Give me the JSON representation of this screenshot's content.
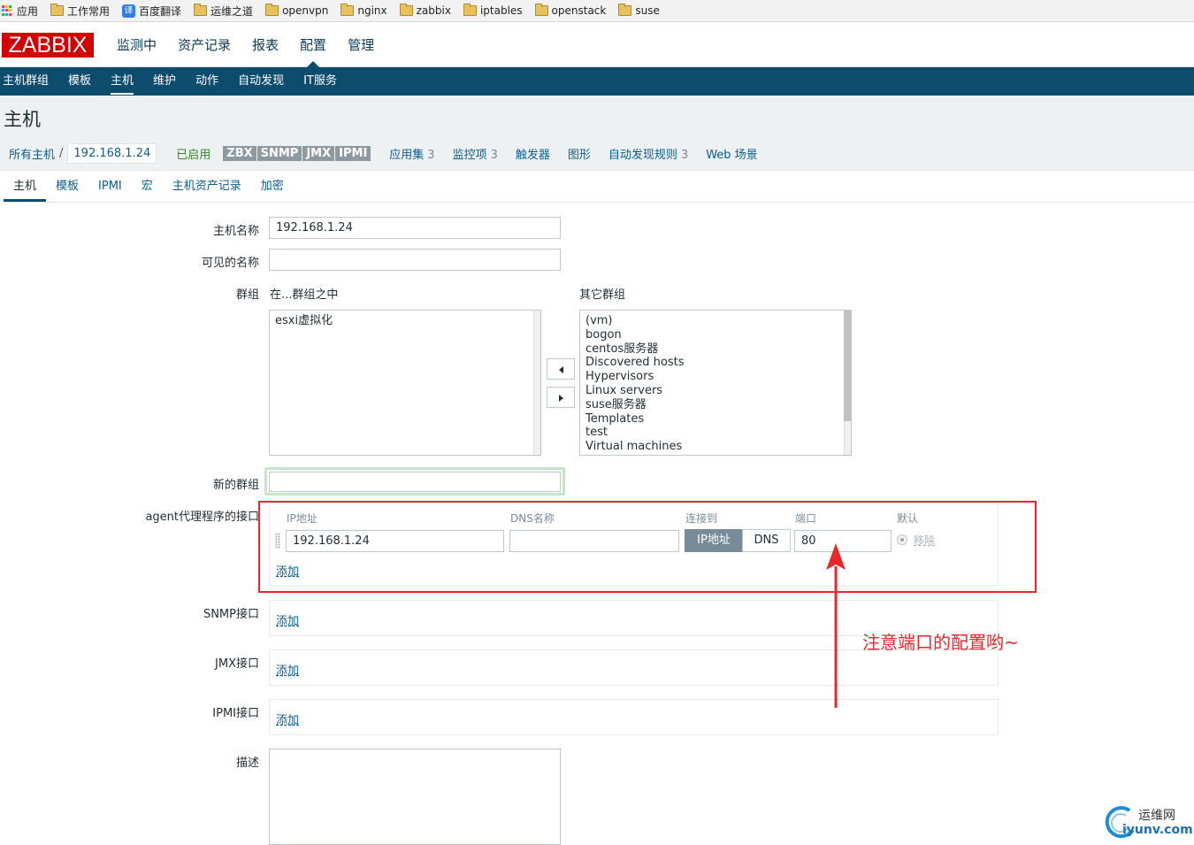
{
  "bookmarks": [
    {
      "label": "应用",
      "icon": "apps-grid-icon"
    },
    {
      "label": "工作常用",
      "icon": "folder-icon"
    },
    {
      "label": "百度翻译",
      "icon": "translate-icon",
      "icon_text": "译"
    },
    {
      "label": "运维之道",
      "icon": "folder-icon"
    },
    {
      "label": "openvpn",
      "icon": "folder-icon"
    },
    {
      "label": "nginx",
      "icon": "folder-icon"
    },
    {
      "label": "zabbix",
      "icon": "folder-icon"
    },
    {
      "label": "iptables",
      "icon": "folder-icon"
    },
    {
      "label": "openstack",
      "icon": "folder-icon"
    },
    {
      "label": "suse",
      "icon": "folder-icon"
    }
  ],
  "logo": "ZABBIX",
  "main_menu": [
    "监测中",
    "资产记录",
    "报表",
    "配置",
    "管理"
  ],
  "main_menu_active": "配置",
  "sub_menu": [
    "主机群组",
    "模板",
    "主机",
    "维护",
    "动作",
    "自动发现",
    "IT服务"
  ],
  "sub_menu_active": "主机",
  "page_title": "主机",
  "breadcrumb": {
    "all_hosts": "所有主机",
    "separator": "/",
    "current": "192.168.1.24",
    "status": "已启用",
    "availability": [
      "ZBX",
      "SNMP",
      "JMX",
      "IPMI"
    ],
    "items": [
      {
        "label": "应用集",
        "count": "3"
      },
      {
        "label": "监控项",
        "count": "3"
      },
      {
        "label": "触发器",
        "count": ""
      },
      {
        "label": "图形",
        "count": ""
      },
      {
        "label": "自动发现规则",
        "count": "3"
      },
      {
        "label": "Web 场景",
        "count": ""
      }
    ]
  },
  "tabs": [
    "主机",
    "模板",
    "IPMI",
    "宏",
    "主机资产记录",
    "加密"
  ],
  "tabs_active": "主机",
  "form": {
    "host_name_label": "主机名称",
    "host_name_value": "192.168.1.24",
    "visible_name_label": "可见的名称",
    "visible_name_value": "",
    "groups_label": "群组",
    "in_groups_label": "在...群组之中",
    "other_groups_label": "其它群组",
    "in_groups": [
      "esxi虚拟化"
    ],
    "other_groups": [
      "(vm)",
      "bogon",
      "centos服务器",
      "Discovered hosts",
      "Hypervisors",
      "Linux servers",
      "suse服务器",
      "Templates",
      "test",
      "Virtual machines"
    ],
    "new_group_label": "新的群组",
    "new_group_value": "",
    "agent_label": "agent代理程序的接口",
    "agent_columns": {
      "ip": "IP地址",
      "dns": "DNS名称",
      "connect": "连接到",
      "port": "端口",
      "default": "默认"
    },
    "agent_ip": "192.168.1.24",
    "agent_dns": "",
    "connect_ip": "IP地址",
    "connect_dns": "DNS",
    "agent_port": "80",
    "remove": "移除",
    "add": "添加",
    "snmp_label": "SNMP接口",
    "jmx_label": "JMX接口",
    "ipmi_label": "IPMI接口",
    "description_label": "描述",
    "description_value": ""
  },
  "annotation": "注意端口的配置哟~",
  "watermark": {
    "line1": "运维网",
    "line2": "iyunv.com"
  },
  "colors": {
    "accent": "#0e4c6e",
    "logo": "#d40000",
    "annotation": "#e8282b",
    "link": "#0a5d8c"
  }
}
